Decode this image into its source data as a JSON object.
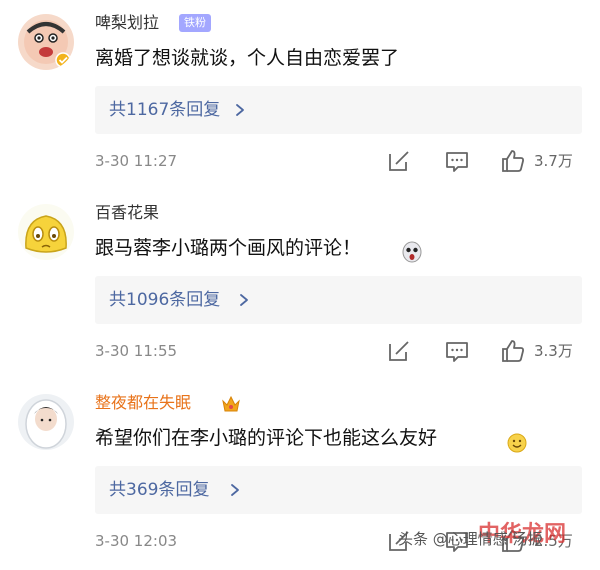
{
  "comments": [
    {
      "username": "啤梨划拉",
      "badge": "铁粉",
      "text": "离婚了想谈就谈，个人自由恋爱罢了",
      "replies": "共1167条回复",
      "time": "3-30 11:27",
      "likes": "3.7万"
    },
    {
      "username": "百香花果",
      "text": "跟马蓉李小璐两个画风的评论！",
      "replies": "共1096条回复",
      "time": "3-30 11:55",
      "likes": "3.3万"
    },
    {
      "username": "整夜都在失眠",
      "text": "希望你们在李小璐的评论下也能这么友好",
      "replies": "共369条回复",
      "time": "3-30 12:03",
      "likes": "2.5万"
    }
  ],
  "watermark": {
    "text": "头条 @心理情感 汤振",
    "logo": "中华龙网"
  },
  "colors": {
    "link": "#4d68a1",
    "badge": "#a3a7ff",
    "orange_name": "#e8731a",
    "muted": "#888888"
  },
  "icons": {
    "edit": "edit-icon",
    "comment": "comment-icon",
    "like": "thumbs-up-icon",
    "chevron": "chevron-right-icon"
  }
}
